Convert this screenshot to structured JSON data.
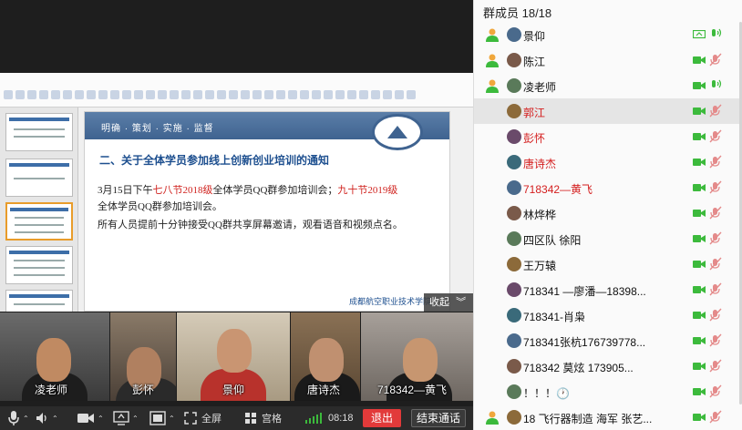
{
  "colors": {
    "accent_green": "#3cba3c",
    "host_red": "#d41e1e",
    "leave_red": "#e23a3a",
    "muted_icon": "#e48a8a"
  },
  "slide": {
    "breadcrumb": "明确 · 策划 · 实施 · 监督",
    "title": "二、关于全体学员参加线上创新创业培训的通知",
    "line1_prefix": "3月15日下午",
    "line1_red1": "七八节2018级",
    "line1_mid": "全体学员QQ群参加培训会；",
    "line1_red2": "九十节2019级",
    "line2": "全体学员QQ群参加培训会。",
    "line3": "所有人员提前十分钟接受QQ群共享屏幕邀请，观看语音和视频点名。",
    "footer": "成都航空职业技术学院"
  },
  "share": {
    "collapse_label": "收起"
  },
  "tiles": [
    {
      "name": "凌老师"
    },
    {
      "name": "彭怀"
    },
    {
      "name": "景仰"
    },
    {
      "name": "唐诗杰"
    },
    {
      "name": "718342—黄飞"
    }
  ],
  "toolbar": {
    "fullscreen_label": "全屏",
    "grid_label": "宫格",
    "time": "08:18",
    "leave_label": "退出",
    "end_label": "结束通话"
  },
  "panel": {
    "title": "群成员 18/18",
    "members": [
      {
        "name": "景仰",
        "host_icon": true,
        "red": false,
        "cam": "screen",
        "mic": "on"
      },
      {
        "name": "陈江",
        "host_icon": true,
        "red": false,
        "cam": "on",
        "mic": "muted"
      },
      {
        "name": "凌老师",
        "host_icon": true,
        "red": false,
        "cam": "on",
        "mic": "on"
      },
      {
        "name": "郭江",
        "host_icon": false,
        "red": true,
        "cam": "on",
        "mic": "muted",
        "selected": true
      },
      {
        "name": "彭怀",
        "host_icon": false,
        "red": true,
        "cam": "on",
        "mic": "muted"
      },
      {
        "name": "唐诗杰",
        "host_icon": false,
        "red": true,
        "cam": "on",
        "mic": "muted"
      },
      {
        "name": "718342—黄飞",
        "host_icon": false,
        "red": true,
        "cam": "on",
        "mic": "muted"
      },
      {
        "name": "林烨桦",
        "host_icon": false,
        "red": false,
        "cam": "on",
        "mic": "muted"
      },
      {
        "name": "四区队  徐阳",
        "host_icon": false,
        "red": false,
        "cam": "on",
        "mic": "muted"
      },
      {
        "name": "王万辕",
        "host_icon": false,
        "red": false,
        "cam": "on",
        "mic": "muted"
      },
      {
        "name": "718341 —廖潘—18398...",
        "host_icon": false,
        "red": false,
        "cam": "on",
        "mic": "muted"
      },
      {
        "name": "718341-肖枭",
        "host_icon": false,
        "red": false,
        "cam": "on",
        "mic": "muted"
      },
      {
        "name": "718341张杭176739778...",
        "host_icon": false,
        "red": false,
        "cam": "on",
        "mic": "muted"
      },
      {
        "name": "718342    莫炫  173905...",
        "host_icon": false,
        "red": false,
        "cam": "on",
        "mic": "muted"
      },
      {
        "name": "！！！🕐",
        "host_icon": false,
        "red": false,
        "cam": "on",
        "mic": "muted"
      },
      {
        "name": "18 飞行器制造 海军 张艺...",
        "host_icon": true,
        "red": false,
        "cam": "on",
        "mic": "muted"
      }
    ]
  }
}
